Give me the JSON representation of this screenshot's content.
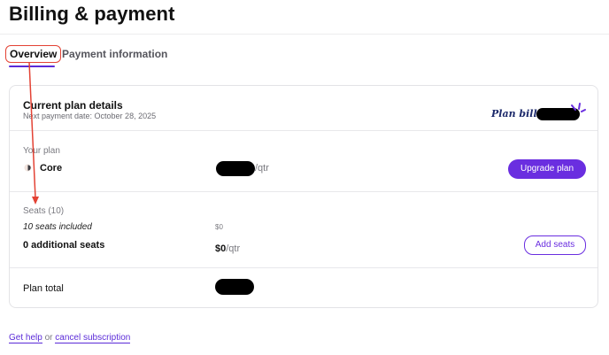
{
  "page": {
    "title": "Billing & payment"
  },
  "tabs": [
    {
      "label": "Overview",
      "active": true
    },
    {
      "label": "Payment information",
      "active": false
    }
  ],
  "plan_details": {
    "title": "Current plan details",
    "next_payment": "Next payment date: October 28, 2025",
    "billed_label": "Plan billed"
  },
  "your_plan": {
    "label": "Your plan",
    "name": "Core",
    "price_suffix": "/qtr",
    "upgrade_label": "Upgrade plan"
  },
  "seats": {
    "label": "Seats (10)",
    "included_text": "10 seats included",
    "included_price": "$0",
    "additional_text": "0 additional seats",
    "additional_price": "$0",
    "additional_suffix": "/qtr",
    "add_label": "Add seats"
  },
  "total": {
    "label": "Plan total"
  },
  "footer": {
    "get_help": "Get help",
    "or": "or",
    "cancel": "cancel subscription"
  },
  "colors": {
    "accent": "#6a2ee0",
    "annotation_red": "#e34234"
  },
  "icons": {
    "core": "core-plan-icon",
    "sparkle": "sparkle-icon"
  }
}
